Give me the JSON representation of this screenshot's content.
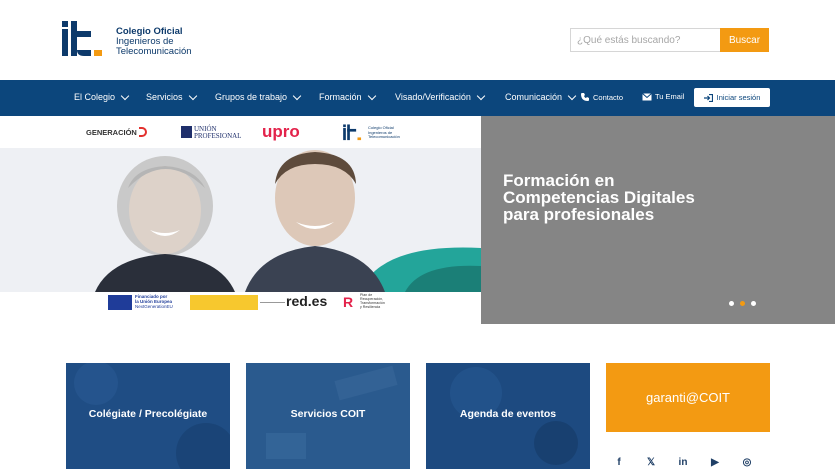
{
  "header": {
    "logo_mark": "it.",
    "logo_lines": [
      "Colegio Oficial",
      "Ingenieros de",
      "Telecomunicación"
    ],
    "search_placeholder": "¿Qué estás buscando?",
    "search_button": "Buscar"
  },
  "nav": {
    "items": [
      {
        "label": "El Colegio"
      },
      {
        "label": "Servicios"
      },
      {
        "label": "Grupos de trabajo"
      },
      {
        "label": "Formación"
      },
      {
        "label": "Visado/Verificación"
      },
      {
        "label": "Comunicación"
      }
    ],
    "contact_label": "Contacto",
    "email_label": "Tu Email",
    "login_label": "Iniciar sesión"
  },
  "hero": {
    "partner_logos": [
      "GENERACIÓN",
      "UNIÓN PROFESIONAL",
      "upro"
    ],
    "coit_logo_lines": [
      "Colegio Oficial",
      "Ingenieros de",
      "Telecomunicación"
    ],
    "title_lines": [
      "Formación en",
      "Competencias Digitales",
      "para profesionales"
    ],
    "funding": {
      "eu_lines": [
        "Financiado por",
        "la Unión Europea",
        "NextGenerationEU"
      ],
      "red_es": "red.es",
      "plan_lines": [
        "Plan de",
        "Recuperación,",
        "Transformación",
        "y Resiliencia"
      ]
    },
    "slides_count": 3,
    "active_slide": 2
  },
  "cards": [
    {
      "label": "Colégiate / Precolégiate"
    },
    {
      "label": "Servicios COIT"
    },
    {
      "label": "Agenda de eventos"
    }
  ],
  "garanti": {
    "label": "garanti@COIT"
  },
  "social": {
    "icons": [
      "facebook-icon",
      "x-icon",
      "linkedin-icon",
      "youtube-icon",
      "instagram-icon"
    ],
    "glyphs": [
      "f",
      "𝕏",
      "in",
      "▶",
      "◎"
    ]
  },
  "colors": {
    "brand_blue": "#0c467c",
    "accent_orange": "#f39a12",
    "hero_gray": "#858585",
    "card_blue": "#1f4d84"
  }
}
